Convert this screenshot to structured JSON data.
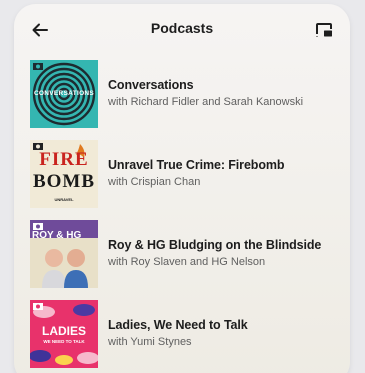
{
  "header": {
    "title": "Podcasts",
    "back_icon": "arrow-left-icon",
    "cast_icon": "cast-icon"
  },
  "podcasts": [
    {
      "name": "Conversations",
      "host": "with Richard Fidler and Sarah Kanowski",
      "art_label": "CONVERSATIONS",
      "art_color": "#33b5b0"
    },
    {
      "name": "Unravel True Crime: Firebomb",
      "host": "with Crispian Chan",
      "art_label_top": "FIRE",
      "art_label_bottom": "BOMB",
      "art_label_small": "UNRAVEL",
      "art_color": "#f1ead7"
    },
    {
      "name": "Roy & HG Bludging on the Blindside",
      "host": "with Roy Slaven and HG Nelson",
      "art_label": "ROY & HG",
      "art_color": "#7a4ea0"
    },
    {
      "name": "Ladies, We Need to Talk",
      "host": "with Yumi Stynes",
      "art_label": "LADIES",
      "art_label_small": "WE NEED TO TALK",
      "art_color": "#e8326b"
    }
  ]
}
